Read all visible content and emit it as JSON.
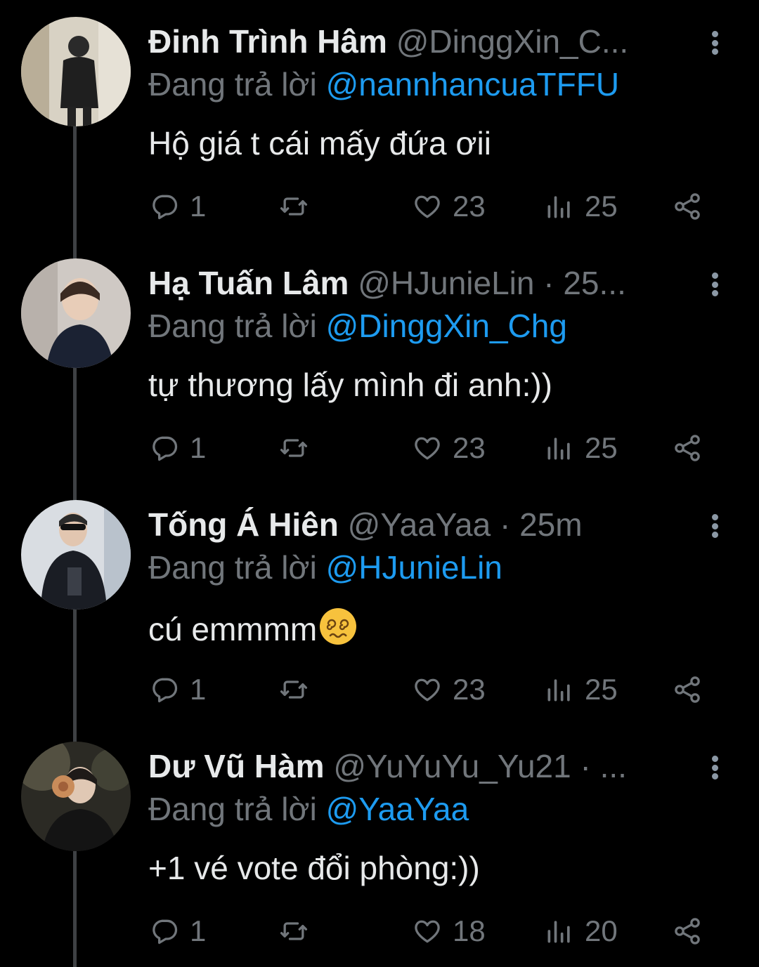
{
  "tweets": [
    {
      "name": "Đinh Trình Hâm",
      "handle": "@DinggXin_C...",
      "reply_label": "Đang trả lời",
      "reply_handle": "@nannhancuaTFFU",
      "text": "Hộ giá t cái mấy đứa ơii",
      "replies": "1",
      "likes": "23",
      "views": "25"
    },
    {
      "name": "Hạ Tuấn Lâm",
      "handle": "@HJunieLin · 25...",
      "reply_label": "Đang trả lời",
      "reply_handle": "@DinggXin_Chg",
      "text": "tự thương lấy mình đi anh:))",
      "replies": "1",
      "likes": "23",
      "views": "25"
    },
    {
      "name": "Tống Á Hiên",
      "handle": "@YaaYaa · 25m",
      "reply_label": "Đang trả lời",
      "reply_handle": "@HJunieLin",
      "text": "cú emmmm",
      "emoji": "dizzy-face-emoji",
      "replies": "1",
      "likes": "23",
      "views": "25"
    },
    {
      "name": "Dư Vũ Hàm",
      "handle": "@YuYuYu_Yu21 · ...",
      "reply_label": "Đang trả lời",
      "reply_handle": "@YaaYaa",
      "text": "+1 vé vote đổi phòng:))",
      "replies": "1",
      "likes": "18",
      "views": "20"
    }
  ],
  "colors": {
    "background": "#000000",
    "text": "#e7e9ea",
    "muted": "#71767b",
    "link": "#1d9bf0",
    "thread_line": "#3e4144"
  },
  "icons": [
    "reply-icon",
    "retweet-icon",
    "like-icon",
    "views-icon",
    "share-icon",
    "more-icon"
  ]
}
